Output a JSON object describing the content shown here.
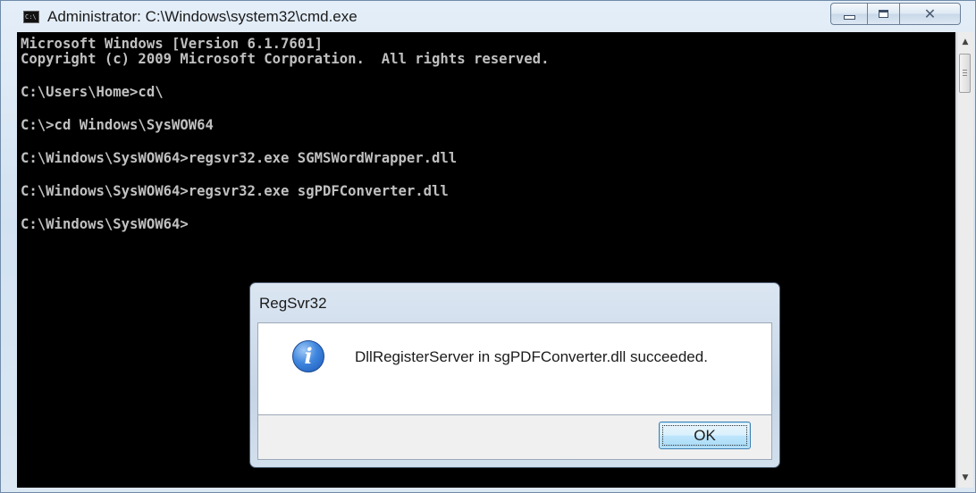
{
  "window": {
    "title": "Administrator: C:\\Windows\\system32\\cmd.exe",
    "icon": "cmd-icon",
    "icon_label": "C:\\",
    "caption_buttons": [
      "minimize-icon",
      "maximize-icon",
      "close-icon"
    ]
  },
  "console": {
    "lines": [
      "Microsoft Windows [Version 6.1.7601]",
      "Copyright (c) 2009 Microsoft Corporation.  All rights reserved.",
      "C:\\Users\\Home>cd\\",
      "C:\\>cd Windows\\SysWOW64",
      "C:\\Windows\\SysWOW64>regsvr32.exe SGMSWordWrapper.dll",
      "C:\\Windows\\SysWOW64>regsvr32.exe sgPDFConverter.dll",
      "C:\\Windows\\SysWOW64>"
    ]
  },
  "dialog": {
    "title": "RegSvr32",
    "icon": "info-icon",
    "message": "DllRegisterServer in sgPDFConverter.dll succeeded.",
    "ok_label": "OK"
  },
  "colors": {
    "console_bg": "#000000",
    "console_text": "#c0c0c0",
    "info_icon": "#3f86de"
  }
}
